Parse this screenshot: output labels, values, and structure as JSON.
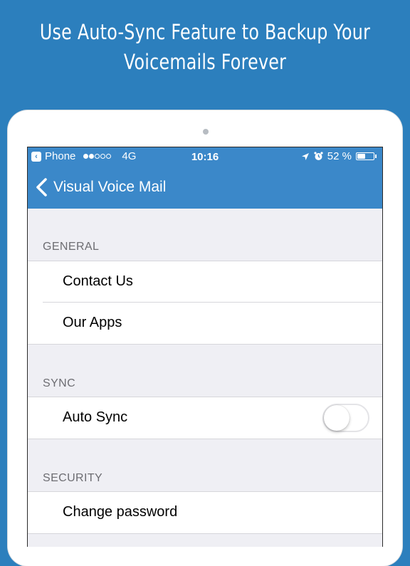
{
  "headline": {
    "line1": "Use Auto-Sync Feature to Backup Your",
    "line2": "Voicemails Forever"
  },
  "status_bar": {
    "back_app": "Phone",
    "signal_bars_on": 2,
    "signal_bars_total": 5,
    "network": "4G",
    "time": "10:16",
    "location_icon": "location-arrow-icon",
    "alarm_icon": "alarm-clock-icon",
    "battery_percent_label": "52 %",
    "battery_level": 0.52
  },
  "nav": {
    "back_label": "Visual Voice Mail"
  },
  "sections": {
    "general": {
      "header": "GENERAL",
      "items": [
        "Contact Us",
        "Our Apps"
      ]
    },
    "sync": {
      "header": "SYNC",
      "items": [
        "Auto Sync"
      ],
      "auto_sync_on": false
    },
    "security": {
      "header": "SECURITY",
      "items": [
        "Change password"
      ]
    }
  },
  "colors": {
    "background": "#2c7fbd",
    "nav_bar": "#3b88c9",
    "group_background": "#efeff4"
  }
}
